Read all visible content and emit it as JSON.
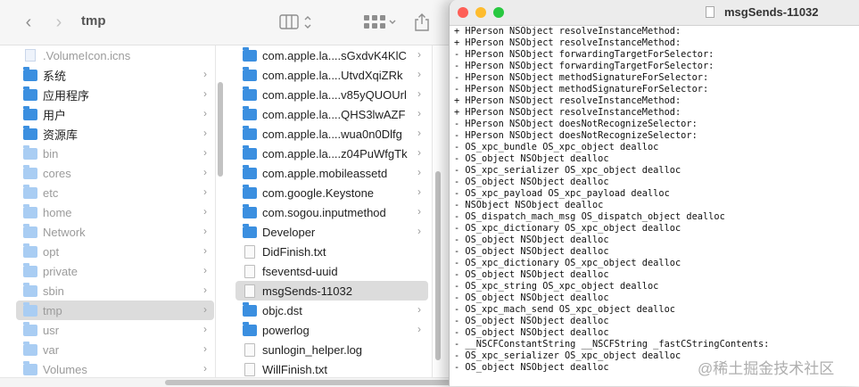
{
  "finder": {
    "current_folder": "tmp",
    "nav": {
      "back": "‹",
      "forward": "›"
    },
    "sidebar_items": [
      {
        "label": ".VolumeIcon.icns",
        "kind": "icns",
        "dim": true,
        "chevron": false
      },
      {
        "label": "系统",
        "kind": "folder",
        "dim": false,
        "chevron": true
      },
      {
        "label": "应用程序",
        "kind": "folder",
        "dim": false,
        "chevron": true
      },
      {
        "label": "用户",
        "kind": "folder",
        "dim": false,
        "chevron": true
      },
      {
        "label": "资源库",
        "kind": "folder",
        "dim": false,
        "chevron": true
      },
      {
        "label": "bin",
        "kind": "folder",
        "dim": true,
        "chevron": true
      },
      {
        "label": "cores",
        "kind": "folder",
        "dim": true,
        "chevron": true
      },
      {
        "label": "etc",
        "kind": "folder",
        "dim": true,
        "chevron": true
      },
      {
        "label": "home",
        "kind": "folder",
        "dim": true,
        "chevron": true
      },
      {
        "label": "Network",
        "kind": "folder",
        "dim": true,
        "chevron": true
      },
      {
        "label": "opt",
        "kind": "folder",
        "dim": true,
        "chevron": true
      },
      {
        "label": "private",
        "kind": "folder",
        "dim": true,
        "chevron": true
      },
      {
        "label": "sbin",
        "kind": "folder",
        "dim": true,
        "chevron": true
      },
      {
        "label": "tmp",
        "kind": "folder",
        "dim": true,
        "chevron": true,
        "selected": true
      },
      {
        "label": "usr",
        "kind": "folder",
        "dim": true,
        "chevron": true
      },
      {
        "label": "var",
        "kind": "folder",
        "dim": true,
        "chevron": true
      },
      {
        "label": "Volumes",
        "kind": "folder",
        "dim": true,
        "chevron": true
      }
    ],
    "tmp_items": [
      {
        "label": "com.apple.la....sGxdvK4KlC",
        "kind": "folder",
        "chevron": true
      },
      {
        "label": "com.apple.la....UtvdXqiZRk",
        "kind": "folder",
        "chevron": true
      },
      {
        "label": "com.apple.la....v85yQUOUrl",
        "kind": "folder",
        "chevron": true
      },
      {
        "label": "com.apple.la....QHS3lwAZF",
        "kind": "folder",
        "chevron": true
      },
      {
        "label": "com.apple.la....wua0n0Dlfg",
        "kind": "folder",
        "chevron": true
      },
      {
        "label": "com.apple.la....z04PuWfgTk",
        "kind": "folder",
        "chevron": true
      },
      {
        "label": "com.apple.mobileassetd",
        "kind": "folder",
        "chevron": true
      },
      {
        "label": "com.google.Keystone",
        "kind": "folder",
        "chevron": true
      },
      {
        "label": "com.sogou.inputmethod",
        "kind": "folder",
        "chevron": true
      },
      {
        "label": "Developer",
        "kind": "folder",
        "chevron": true
      },
      {
        "label": "DidFinish.txt",
        "kind": "file",
        "chevron": false
      },
      {
        "label": "fseventsd-uuid",
        "kind": "file",
        "chevron": false
      },
      {
        "label": "msgSends-11032",
        "kind": "file",
        "chevron": false,
        "selected": true
      },
      {
        "label": "objc.dst",
        "kind": "folder",
        "chevron": true
      },
      {
        "label": "powerlog",
        "kind": "folder",
        "chevron": true
      },
      {
        "label": "sunlogin_helper.log",
        "kind": "file",
        "chevron": false
      },
      {
        "label": "WillFinish.txt",
        "kind": "file",
        "chevron": false
      }
    ]
  },
  "terminal": {
    "title": "msgSends-11032",
    "lines": [
      "+ HPerson NSObject resolveInstanceMethod:",
      "+ HPerson NSObject resolveInstanceMethod:",
      "- HPerson NSObject forwardingTargetForSelector:",
      "- HPerson NSObject forwardingTargetForSelector:",
      "- HPerson NSObject methodSignatureForSelector:",
      "- HPerson NSObject methodSignatureForSelector:",
      "+ HPerson NSObject resolveInstanceMethod:",
      "+ HPerson NSObject resolveInstanceMethod:",
      "- HPerson NSObject doesNotRecognizeSelector:",
      "- HPerson NSObject doesNotRecognizeSelector:",
      "- OS_xpc_bundle OS_xpc_object dealloc",
      "- OS_object NSObject dealloc",
      "- OS_xpc_serializer OS_xpc_object dealloc",
      "- OS_object NSObject dealloc",
      "- OS_xpc_payload OS_xpc_payload dealloc",
      "- NSObject NSObject dealloc",
      "- OS_dispatch_mach_msg OS_dispatch_object dealloc",
      "- OS_xpc_dictionary OS_xpc_object dealloc",
      "- OS_object NSObject dealloc",
      "- OS_object NSObject dealloc",
      "- OS_xpc_dictionary OS_xpc_object dealloc",
      "- OS_object NSObject dealloc",
      "- OS_xpc_string OS_xpc_object dealloc",
      "- OS_object NSObject dealloc",
      "- OS_xpc_mach_send OS_xpc_object dealloc",
      "- OS_object NSObject dealloc",
      "- OS_object NSObject dealloc",
      "- __NSCFConstantString __NSCFString _fastCStringContents:",
      "- OS_xpc_serializer OS_xpc_object dealloc",
      "- OS_object NSObject dealloc"
    ]
  },
  "watermark": "@稀土掘金技术社区",
  "colors": {
    "folder": "#3b8fe0",
    "close": "#fe5f57",
    "minimize": "#febc2e",
    "zoom": "#28c840"
  }
}
